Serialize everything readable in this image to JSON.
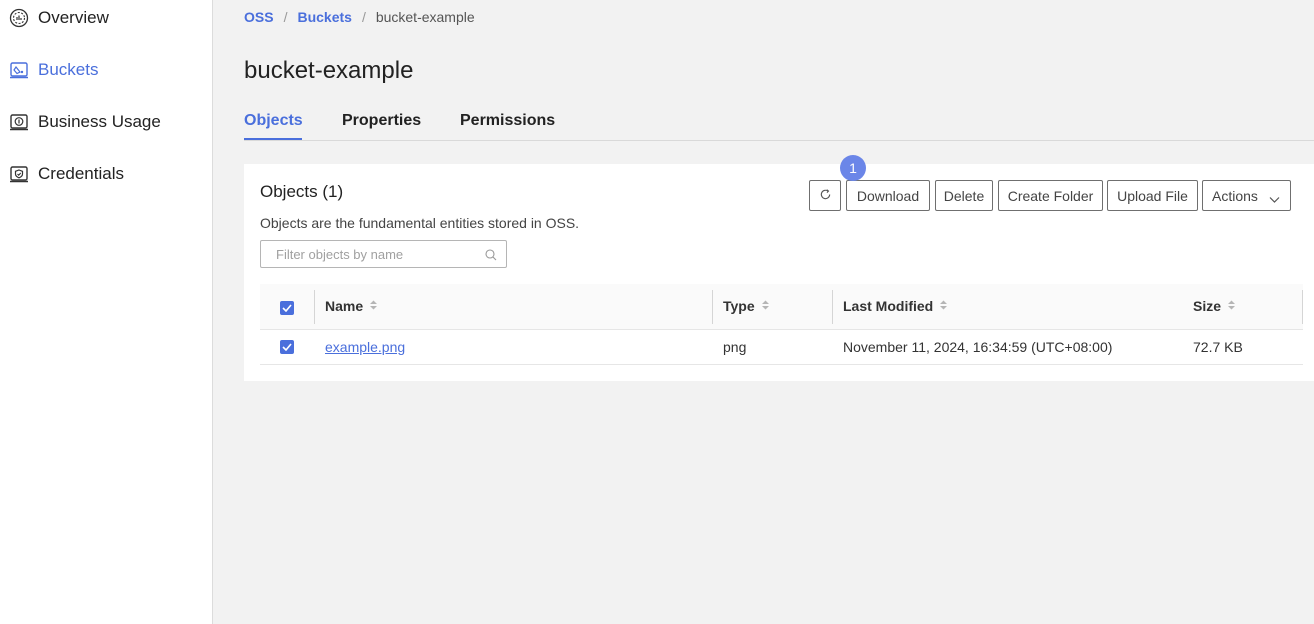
{
  "sidebar": {
    "items": [
      {
        "label": "Overview",
        "icon": "overview-icon",
        "active": false
      },
      {
        "label": "Buckets",
        "icon": "bucket-icon",
        "active": true
      },
      {
        "label": "Business Usage",
        "icon": "usage-icon",
        "active": false
      },
      {
        "label": "Credentials",
        "icon": "credentials-icon",
        "active": false
      }
    ]
  },
  "breadcrumb": {
    "items": [
      "OSS",
      "Buckets",
      "bucket-example"
    ],
    "separator": "/"
  },
  "page": {
    "title": "bucket-example"
  },
  "tabs": [
    {
      "label": "Objects",
      "active": true
    },
    {
      "label": "Properties",
      "active": false
    },
    {
      "label": "Permissions",
      "active": false
    }
  ],
  "panel": {
    "title": "Objects (1)",
    "description": "Objects are the fundamental entities stored in OSS.",
    "search_placeholder": "Filter objects by name",
    "badge": "1"
  },
  "toolbar": {
    "refresh_icon": "refresh-icon",
    "download_label": "Download",
    "delete_label": "Delete",
    "create_folder_label": "Create Folder",
    "upload_file_label": "Upload File",
    "actions_label": "Actions"
  },
  "table": {
    "columns": [
      "Name",
      "Type",
      "Last Modified",
      "Size"
    ],
    "rows": [
      {
        "selected": true,
        "name": "example.png",
        "type": "png",
        "last_modified": "November 11, 2024, 16:34:59 (UTC+08:00)",
        "size": "72.7 KB"
      }
    ]
  },
  "colors": {
    "accent": "#4a6fdc",
    "badge": "#6b86e8",
    "background": "#f2f2f2"
  }
}
